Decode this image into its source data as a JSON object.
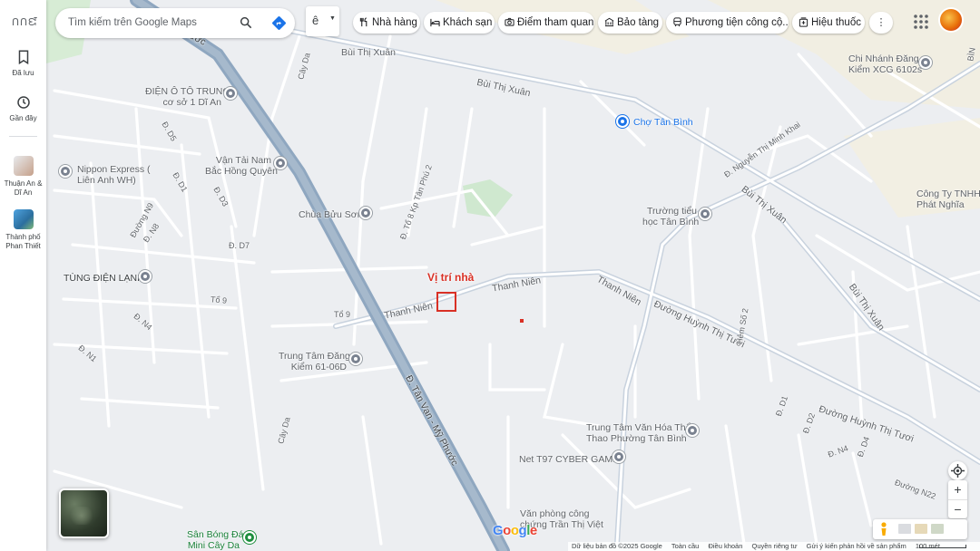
{
  "rail": {
    "logo": "ᑎᑎᘿ",
    "saved": "Đã lưu",
    "recent": "Gần đây",
    "recent_place_1": "Thuận An & Dĩ An",
    "recent_place_2": "Thành phố Phan Thiết"
  },
  "search": {
    "placeholder": "Tìm kiếm trên Google Maps"
  },
  "menu_button": {
    "glyph": "ê"
  },
  "chips": [
    {
      "label": "Nhà hàng",
      "icon": "restaurant-icon"
    },
    {
      "label": "Khách sạn",
      "icon": "hotel-icon"
    },
    {
      "label": "Điểm tham quan",
      "icon": "camera-icon"
    },
    {
      "label": "Bảo tàng",
      "icon": "museum-icon"
    },
    {
      "label": "Phương tiện công cộ...",
      "icon": "transit-icon"
    },
    {
      "label": "Hiệu thuốc",
      "icon": "pharmacy-icon"
    }
  ],
  "more_chips": "⋮",
  "annotation": {
    "label": "Vị trí nhà",
    "color": "#d93025"
  },
  "places": {
    "p1": "ĐIỆN Ô TÔ TRUNG",
    "p1b": "cơ sở 1 Dĩ An",
    "p2": "Nippon Express (",
    "p2b": "Liên Anh WH)",
    "p3": "Vận Tải Nam",
    "p3b": "Bắc Hồng Quyên",
    "p4": "Chùa Bửu Sơn",
    "p5": "TÙNG ĐIỆN LẠNH",
    "p6": "Trung Tâm Đăng",
    "p6b": "Kiểm 61-06D",
    "p7": "Chợ Tân Bình",
    "p8": "Chi Nhánh Đăng",
    "p8b": "Kiểm XCG 6102s",
    "p9": "Trường tiểu",
    "p9b": "học Tân Bình",
    "p10": "Công Ty TNHH",
    "p10b": "Phát Nghĩa",
    "p11": "Trung Tâm Văn Hóa Thể",
    "p11b": "Thao Phường Tân Bình",
    "p12": "Net T97 CYBER GAME",
    "p13": "Văn phòng công",
    "p13b": "chứng Trần Thị Việt",
    "p14": "Sân Bóng Đá",
    "p14b": "Mini Cây Da"
  },
  "roads": {
    "r1": "Bùi Thị Xuân",
    "r2": "Bùi Thị Xuân",
    "r3": "Bùi Thị Xuân",
    "r4": "Bùi Thị Xuân",
    "r5": "Thanh Niên",
    "r6": "Thanh Niên",
    "r7": "Thanh Niên",
    "r8": "Đường Huỳnh Thị Tươi",
    "r9": "Đường Huỳnh Thị Tươi",
    "r10": "Đ. Tân Vạn - Mỹ Phước",
    "r11": "Mỹ Phước",
    "r12": "Đ. Nguyễn Thị Minh Khai",
    "r13": "Cây Da",
    "r14": "Cây Da",
    "r15": "Tổ 9",
    "r16": "Tổ 9",
    "r17": "Đ. Tổ 8 Kp Tân Phú 2",
    "r18": "Hẻm Số 2",
    "r19": "Đường N22",
    "r20": "Đ. D5",
    "r21": "Đ. D1",
    "r22": "Đ. D3",
    "r23": "Đường N9",
    "r24": "Đ. N8",
    "r25": "Đ. D7",
    "r26": "Đ. N4",
    "r27": "Đ. N1",
    "r28": "Đ. D1",
    "r29": "Đ. D2",
    "r30": "Đ. N4",
    "r31": "Đ. D4",
    "r32": "BÌN"
  },
  "google_logo": "Google",
  "footer": {
    "data": "Dữ liệu bản đồ ©2025 Google",
    "global": "Toàn cầu",
    "terms": "Điều khoản",
    "privacy": "Quyền riêng tư",
    "feedback": "Gửi ý kiến phản hồi về sản phẩm",
    "scale": "100 mét"
  }
}
